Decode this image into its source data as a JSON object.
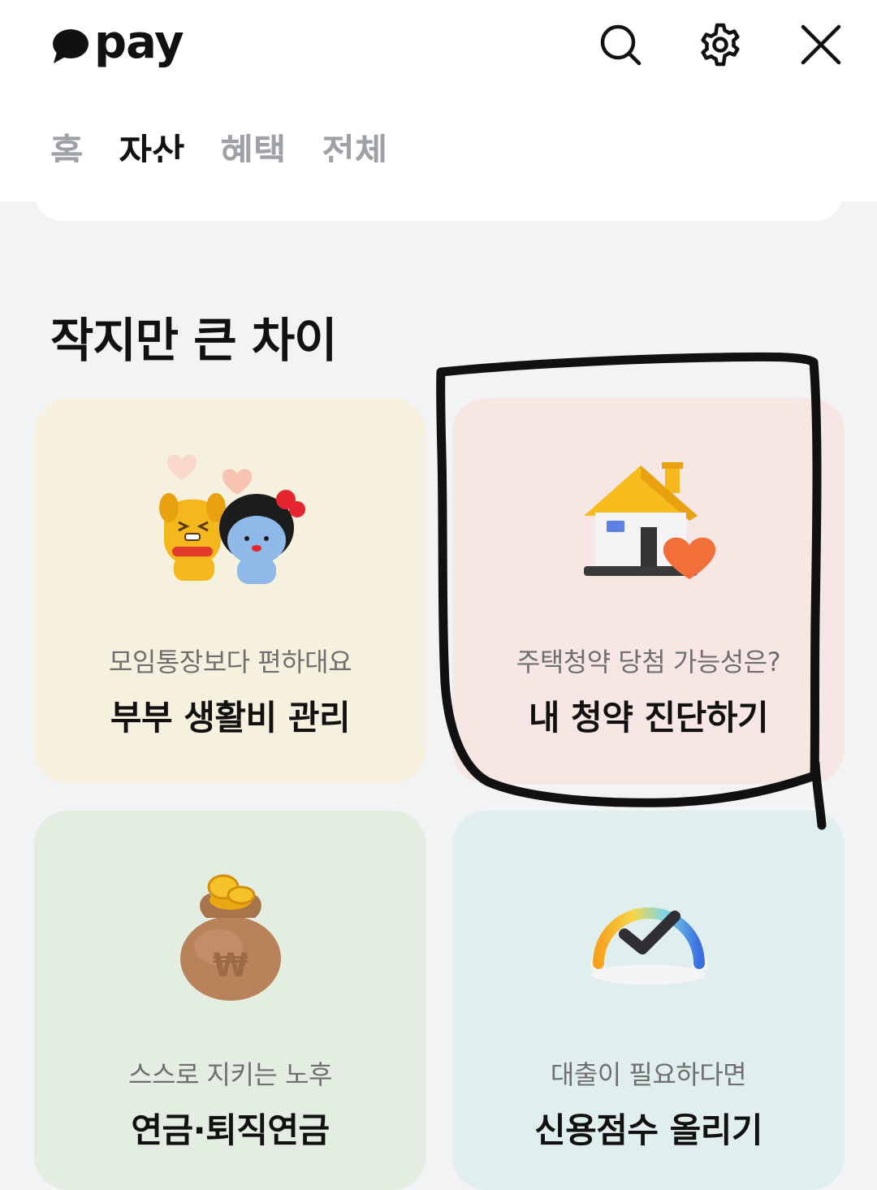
{
  "header": {
    "logo_text": "pay",
    "icons": [
      "search-icon",
      "gear-icon",
      "close-icon"
    ]
  },
  "tabs": [
    {
      "label": "홈",
      "active": false
    },
    {
      "label": "자산",
      "active": true
    },
    {
      "label": "혜택",
      "active": false
    },
    {
      "label": "전체",
      "active": false
    }
  ],
  "section": {
    "title": "작지만 큰 차이"
  },
  "cards": [
    {
      "subtitle": "모임통장보다 편하대요",
      "title": "부부 생활비 관리",
      "icon": "couple-characters-icon",
      "bg": "#f6f1df"
    },
    {
      "subtitle": "주택청약 당첨 가능성은?",
      "title": "내 청약 진단하기",
      "icon": "house-heart-icon",
      "bg": "#f6e6e4"
    },
    {
      "subtitle": "스스로 지키는 노후",
      "title": "연금·퇴직연금",
      "icon": "money-bag-icon",
      "bg": "#e4ede1"
    },
    {
      "subtitle": "대출이 필요하다면",
      "title": "신용점수 올리기",
      "icon": "credit-gauge-icon",
      "bg": "#e0efee"
    }
  ],
  "colors": {
    "background": "#f2f3f5",
    "header": "#ffffff",
    "tab_inactive": "#9ea1a6",
    "text": "#111111",
    "annotation": "#111111"
  }
}
